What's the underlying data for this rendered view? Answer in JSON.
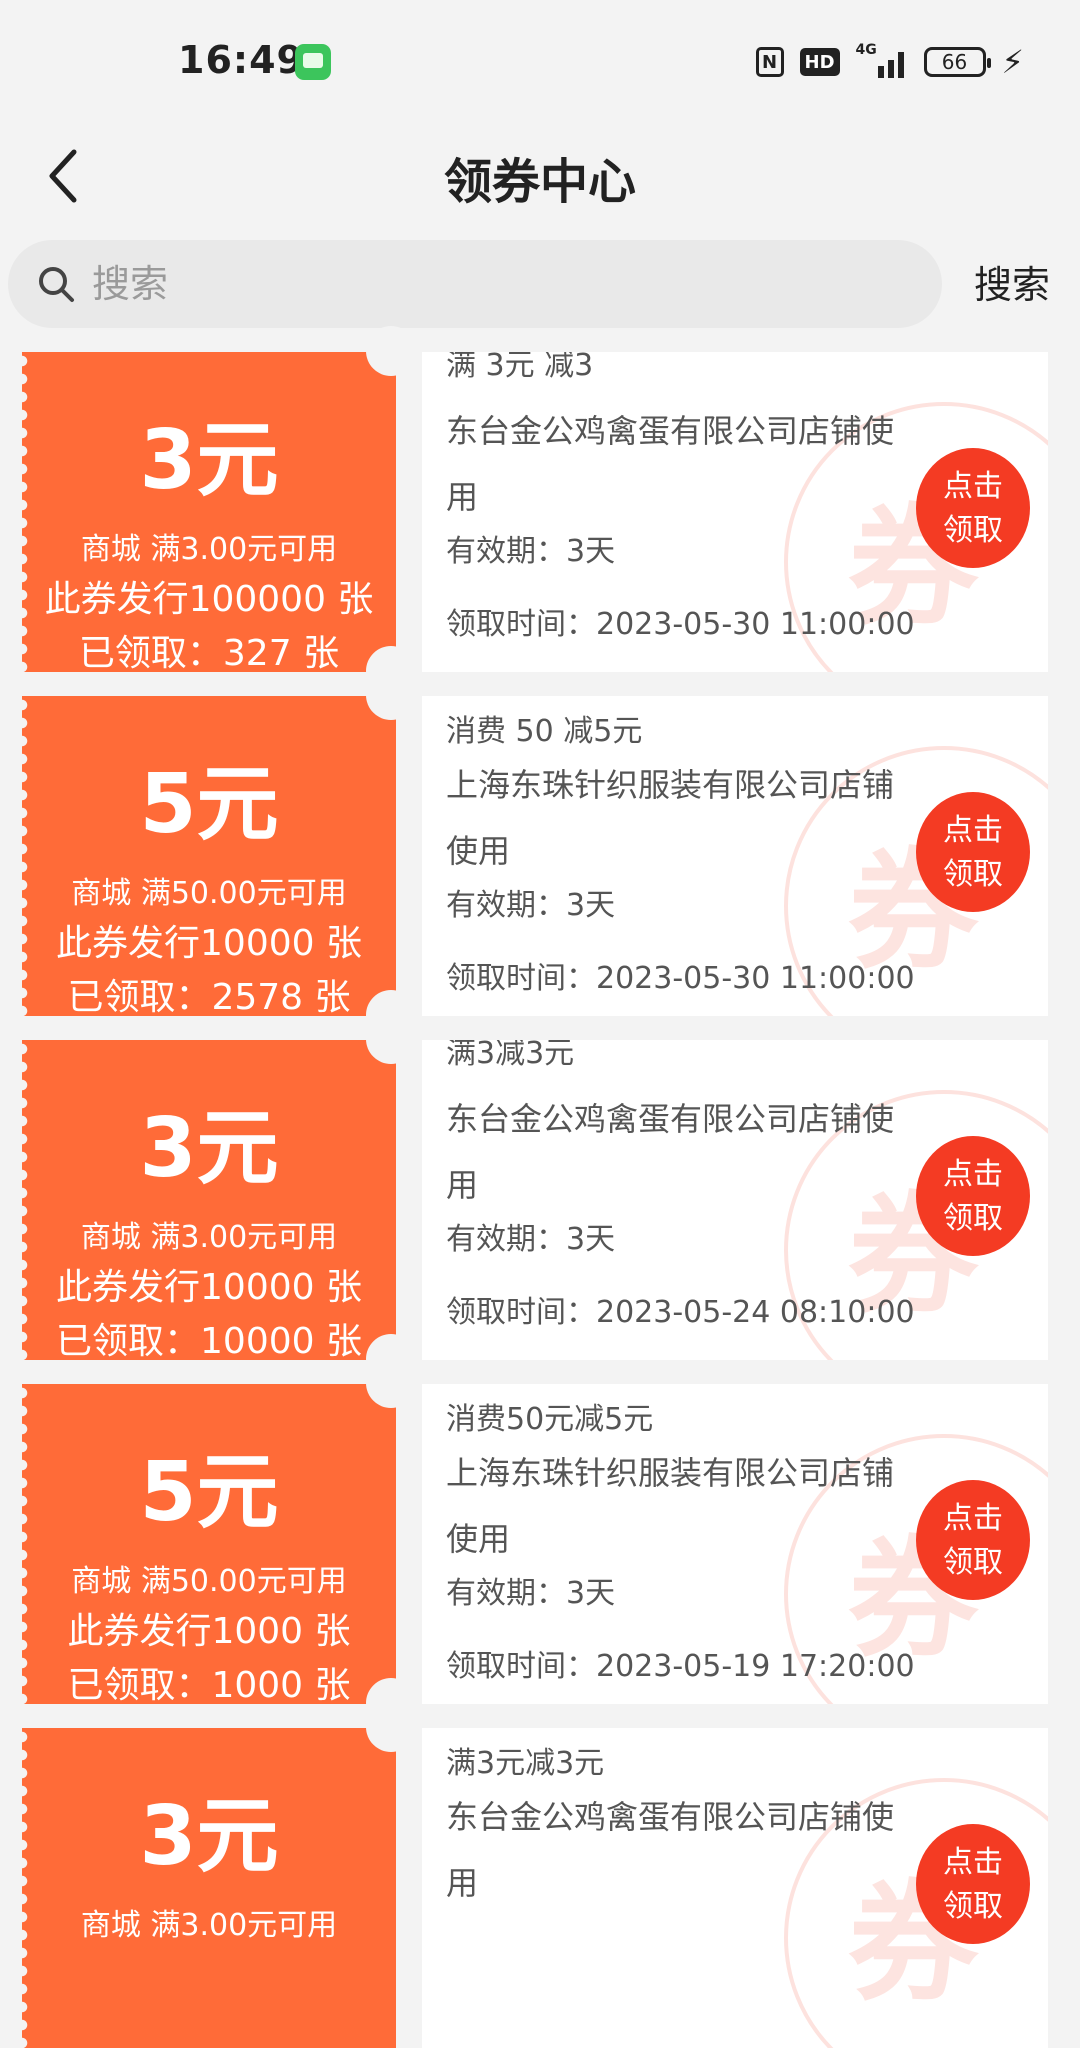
{
  "status_bar": {
    "time": "16:49",
    "network": "4G",
    "hd_label": "HD",
    "nfc_label": "N",
    "battery": "66"
  },
  "nav": {
    "title": "领券中心"
  },
  "search": {
    "placeholder": "搜索",
    "button_label": "搜索"
  },
  "colors": {
    "coupon_accent": "#ff6b38",
    "claim_button": "#f43b23"
  },
  "watermark_char": "券",
  "coupons": [
    {
      "amount": "3元",
      "condition": "商城 满3.00元可用",
      "issued": "此券发行100000 张",
      "claimed": "已领取：327 张",
      "title": "满 3元 减3",
      "shop": "东台金公鸡禽蛋有限公司店铺使用",
      "validity": "有效期：3天",
      "claim_time": "领取时间：2023-05-30 11:00:00",
      "button": "点击领取"
    },
    {
      "amount": "5元",
      "condition": "商城 满50.00元可用",
      "issued": "此券发行10000 张",
      "claimed": "已领取：2578 张",
      "title": "消费 50 减5元",
      "shop": "上海东珠针织服装有限公司店铺使用",
      "validity": "有效期：3天",
      "claim_time": "领取时间：2023-05-30 11:00:00",
      "button": "点击领取"
    },
    {
      "amount": "3元",
      "condition": "商城 满3.00元可用",
      "issued": "此券发行10000 张",
      "claimed": "已领取：10000 张",
      "title": "满3减3元",
      "shop": "东台金公鸡禽蛋有限公司店铺使用",
      "validity": "有效期：3天",
      "claim_time": "领取时间：2023-05-24 08:10:00",
      "button": "点击领取"
    },
    {
      "amount": "5元",
      "condition": "商城 满50.00元可用",
      "issued": "此券发行1000 张",
      "claimed": "已领取：1000 张",
      "title": "消费50元减5元",
      "shop": "上海东珠针织服装有限公司店铺使用",
      "validity": "有效期：3天",
      "claim_time": "领取时间：2023-05-19 17:20:00",
      "button": "点击领取"
    },
    {
      "amount": "3元",
      "condition": "商城 满3.00元可用",
      "issued": "",
      "claimed": "",
      "title": "满3元减3元",
      "shop": "东台金公鸡禽蛋有限公司店铺使用",
      "validity": "",
      "claim_time": "",
      "button": "点击领取"
    }
  ]
}
